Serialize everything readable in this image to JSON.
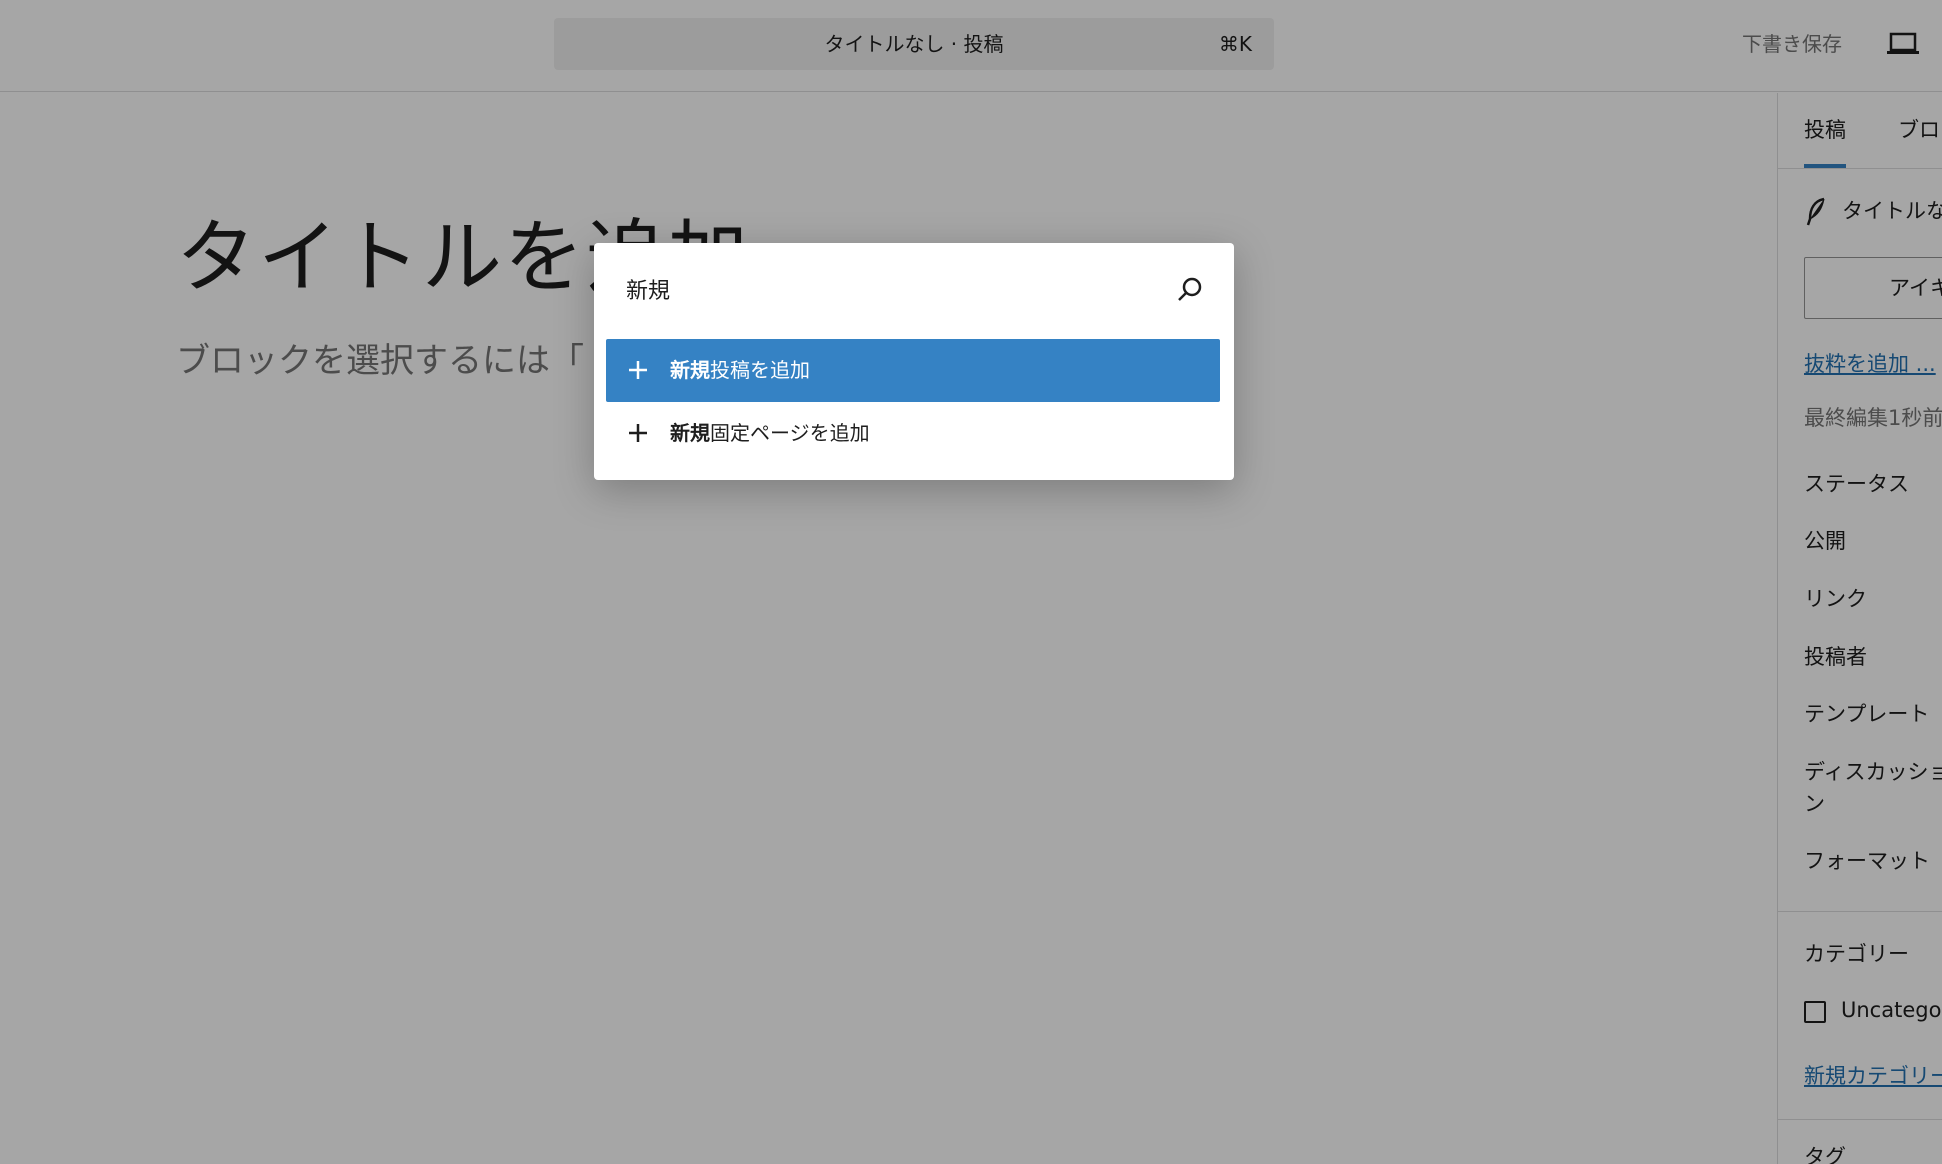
{
  "topbar": {
    "doc_title": "タイトルなし · 投稿",
    "shortcut": "⌘K",
    "save_draft": "下書き保存"
  },
  "editor": {
    "title_placeholder": "タイトルを追加",
    "block_hint": "ブロックを選択するには「"
  },
  "sidebar": {
    "tabs": [
      "投稿",
      "ブロッ"
    ],
    "post_title": "タイトルな",
    "featured_image": "アイキ",
    "add_excerpt": "抜粋を追加 ...",
    "last_edited": "最終編集1秒前。",
    "status": "ステータス",
    "publish": "公開",
    "link": "リンク",
    "author": "投稿者",
    "template": "テンプレート",
    "discussion_line1": "ディスカッショ",
    "discussion_line2": "ン",
    "format": "フォーマット",
    "categories": "カテゴリー",
    "uncategorized": "Uncategor",
    "new_category": "新規カテゴリー",
    "tags": "タグ"
  },
  "palette": {
    "query": "新規",
    "items": [
      {
        "match": "新規",
        "rest": "投稿を追加",
        "selected": true
      },
      {
        "match": "新規",
        "rest": "固定ページを追加",
        "selected": false
      }
    ]
  },
  "colors": {
    "accent": "#3582c4",
    "link": "#2271b1",
    "overlay": "rgba(0,0,0,0.35)"
  }
}
